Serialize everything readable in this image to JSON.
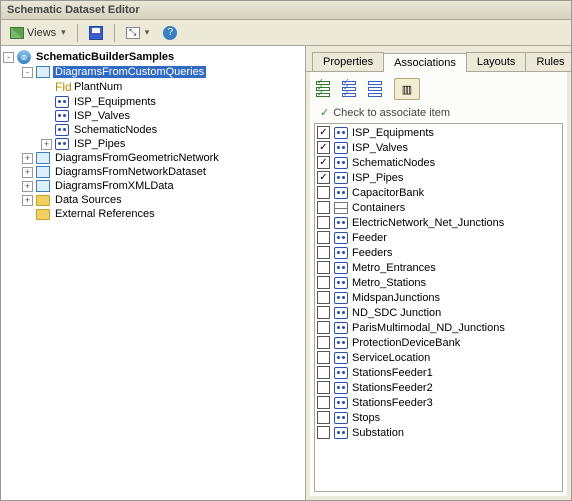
{
  "window": {
    "title": "Schematic Dataset Editor"
  },
  "toolbar": {
    "views_label": "Views"
  },
  "tree": {
    "root": {
      "label": "SchematicBuilderSamples"
    },
    "items": [
      {
        "indent": 0,
        "toggle": "-",
        "icon": "globe",
        "bold": true,
        "data_name": "tree-root",
        "label_ref": "tree.root.label"
      },
      {
        "indent": 1,
        "toggle": "-",
        "icon": "diag",
        "selected": true,
        "data_name": "tree-item-diagrams-from-custom-queries",
        "label": "DiagramsFromCustomQueries"
      },
      {
        "indent": 2,
        "toggle": "",
        "icon": "fld",
        "data_name": "tree-field-plantnum",
        "label": "PlantNum",
        "prefix": "Fld"
      },
      {
        "indent": 2,
        "toggle": "",
        "icon": "node",
        "data_name": "tree-isp-equipments",
        "label": "ISP_Equipments"
      },
      {
        "indent": 2,
        "toggle": "",
        "icon": "node",
        "data_name": "tree-isp-valves",
        "label": "ISP_Valves"
      },
      {
        "indent": 2,
        "toggle": "",
        "icon": "node",
        "data_name": "tree-schematicnodes",
        "label": "SchematicNodes"
      },
      {
        "indent": 2,
        "toggle": "+",
        "icon": "node",
        "data_name": "tree-isp-pipes",
        "label": "ISP_Pipes"
      },
      {
        "indent": 1,
        "toggle": "+",
        "icon": "diag",
        "data_name": "tree-item-geometric-network",
        "label": "DiagramsFromGeometricNetwork"
      },
      {
        "indent": 1,
        "toggle": "+",
        "icon": "diag",
        "data_name": "tree-item-network-dataset",
        "label": "DiagramsFromNetworkDataset"
      },
      {
        "indent": 1,
        "toggle": "+",
        "icon": "diag",
        "data_name": "tree-item-xml-data",
        "label": "DiagramsFromXMLData"
      },
      {
        "indent": 1,
        "toggle": "+",
        "icon": "folder",
        "data_name": "tree-data-sources",
        "label": "Data Sources"
      },
      {
        "indent": 1,
        "toggle": "",
        "icon": "folder",
        "data_name": "tree-external-references",
        "label": "External References"
      }
    ]
  },
  "tabs": {
    "properties": "Properties",
    "associations": "Associations",
    "layouts": "Layouts",
    "rules": "Rules",
    "active_index": 1
  },
  "assoc_panel": {
    "hint": "Check to associate item",
    "items": [
      {
        "checked": true,
        "icon": "node",
        "label": "ISP_Equipments"
      },
      {
        "checked": true,
        "icon": "node",
        "label": "ISP_Valves"
      },
      {
        "checked": true,
        "icon": "node",
        "label": "SchematicNodes"
      },
      {
        "checked": true,
        "icon": "node",
        "label": "ISP_Pipes"
      },
      {
        "checked": false,
        "icon": "node",
        "label": "CapacitorBank"
      },
      {
        "checked": false,
        "icon": "table",
        "label": "Containers"
      },
      {
        "checked": false,
        "icon": "node",
        "label": "ElectricNetwork_Net_Junctions"
      },
      {
        "checked": false,
        "icon": "node",
        "label": "Feeder"
      },
      {
        "checked": false,
        "icon": "node",
        "label": "Feeders"
      },
      {
        "checked": false,
        "icon": "node",
        "label": "Metro_Entrances"
      },
      {
        "checked": false,
        "icon": "node",
        "label": "Metro_Stations"
      },
      {
        "checked": false,
        "icon": "node",
        "label": "MidspanJunctions"
      },
      {
        "checked": false,
        "icon": "node",
        "label": "ND_SDC Junction"
      },
      {
        "checked": false,
        "icon": "node",
        "label": "ParisMultimodal_ND_Junctions"
      },
      {
        "checked": false,
        "icon": "node",
        "label": "ProtectionDeviceBank"
      },
      {
        "checked": false,
        "icon": "node",
        "label": "ServiceLocation"
      },
      {
        "checked": false,
        "icon": "node",
        "label": "StationsFeeder1"
      },
      {
        "checked": false,
        "icon": "node",
        "label": "StationsFeeder2"
      },
      {
        "checked": false,
        "icon": "node",
        "label": "StationsFeeder3"
      },
      {
        "checked": false,
        "icon": "node",
        "label": "Stops"
      },
      {
        "checked": false,
        "icon": "node",
        "label": "Substation"
      }
    ]
  }
}
